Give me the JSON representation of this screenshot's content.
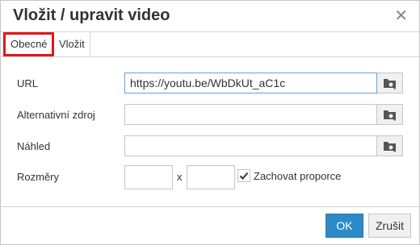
{
  "dialog": {
    "title": "Vložit / upravit video",
    "close_icon": "close-icon"
  },
  "tabs": [
    {
      "label": "Obecné",
      "active": true
    },
    {
      "label": "Vložit",
      "active": false
    }
  ],
  "form": {
    "url": {
      "label": "URL",
      "value": "https://youtu.be/WbDkUt_aC1c"
    },
    "alt_source": {
      "label": "Alternativní zdroj",
      "value": ""
    },
    "preview": {
      "label": "Náhled",
      "value": ""
    },
    "dimensions": {
      "label": "Rozměry",
      "width": "",
      "height": "",
      "separator": "x",
      "keep_ratio_label": "Zachovat proporce",
      "keep_ratio_checked": true
    }
  },
  "buttons": {
    "ok": "OK",
    "cancel": "Zrušit"
  },
  "colors": {
    "accent": "#2d8ac7",
    "highlight": "#e3151a"
  }
}
